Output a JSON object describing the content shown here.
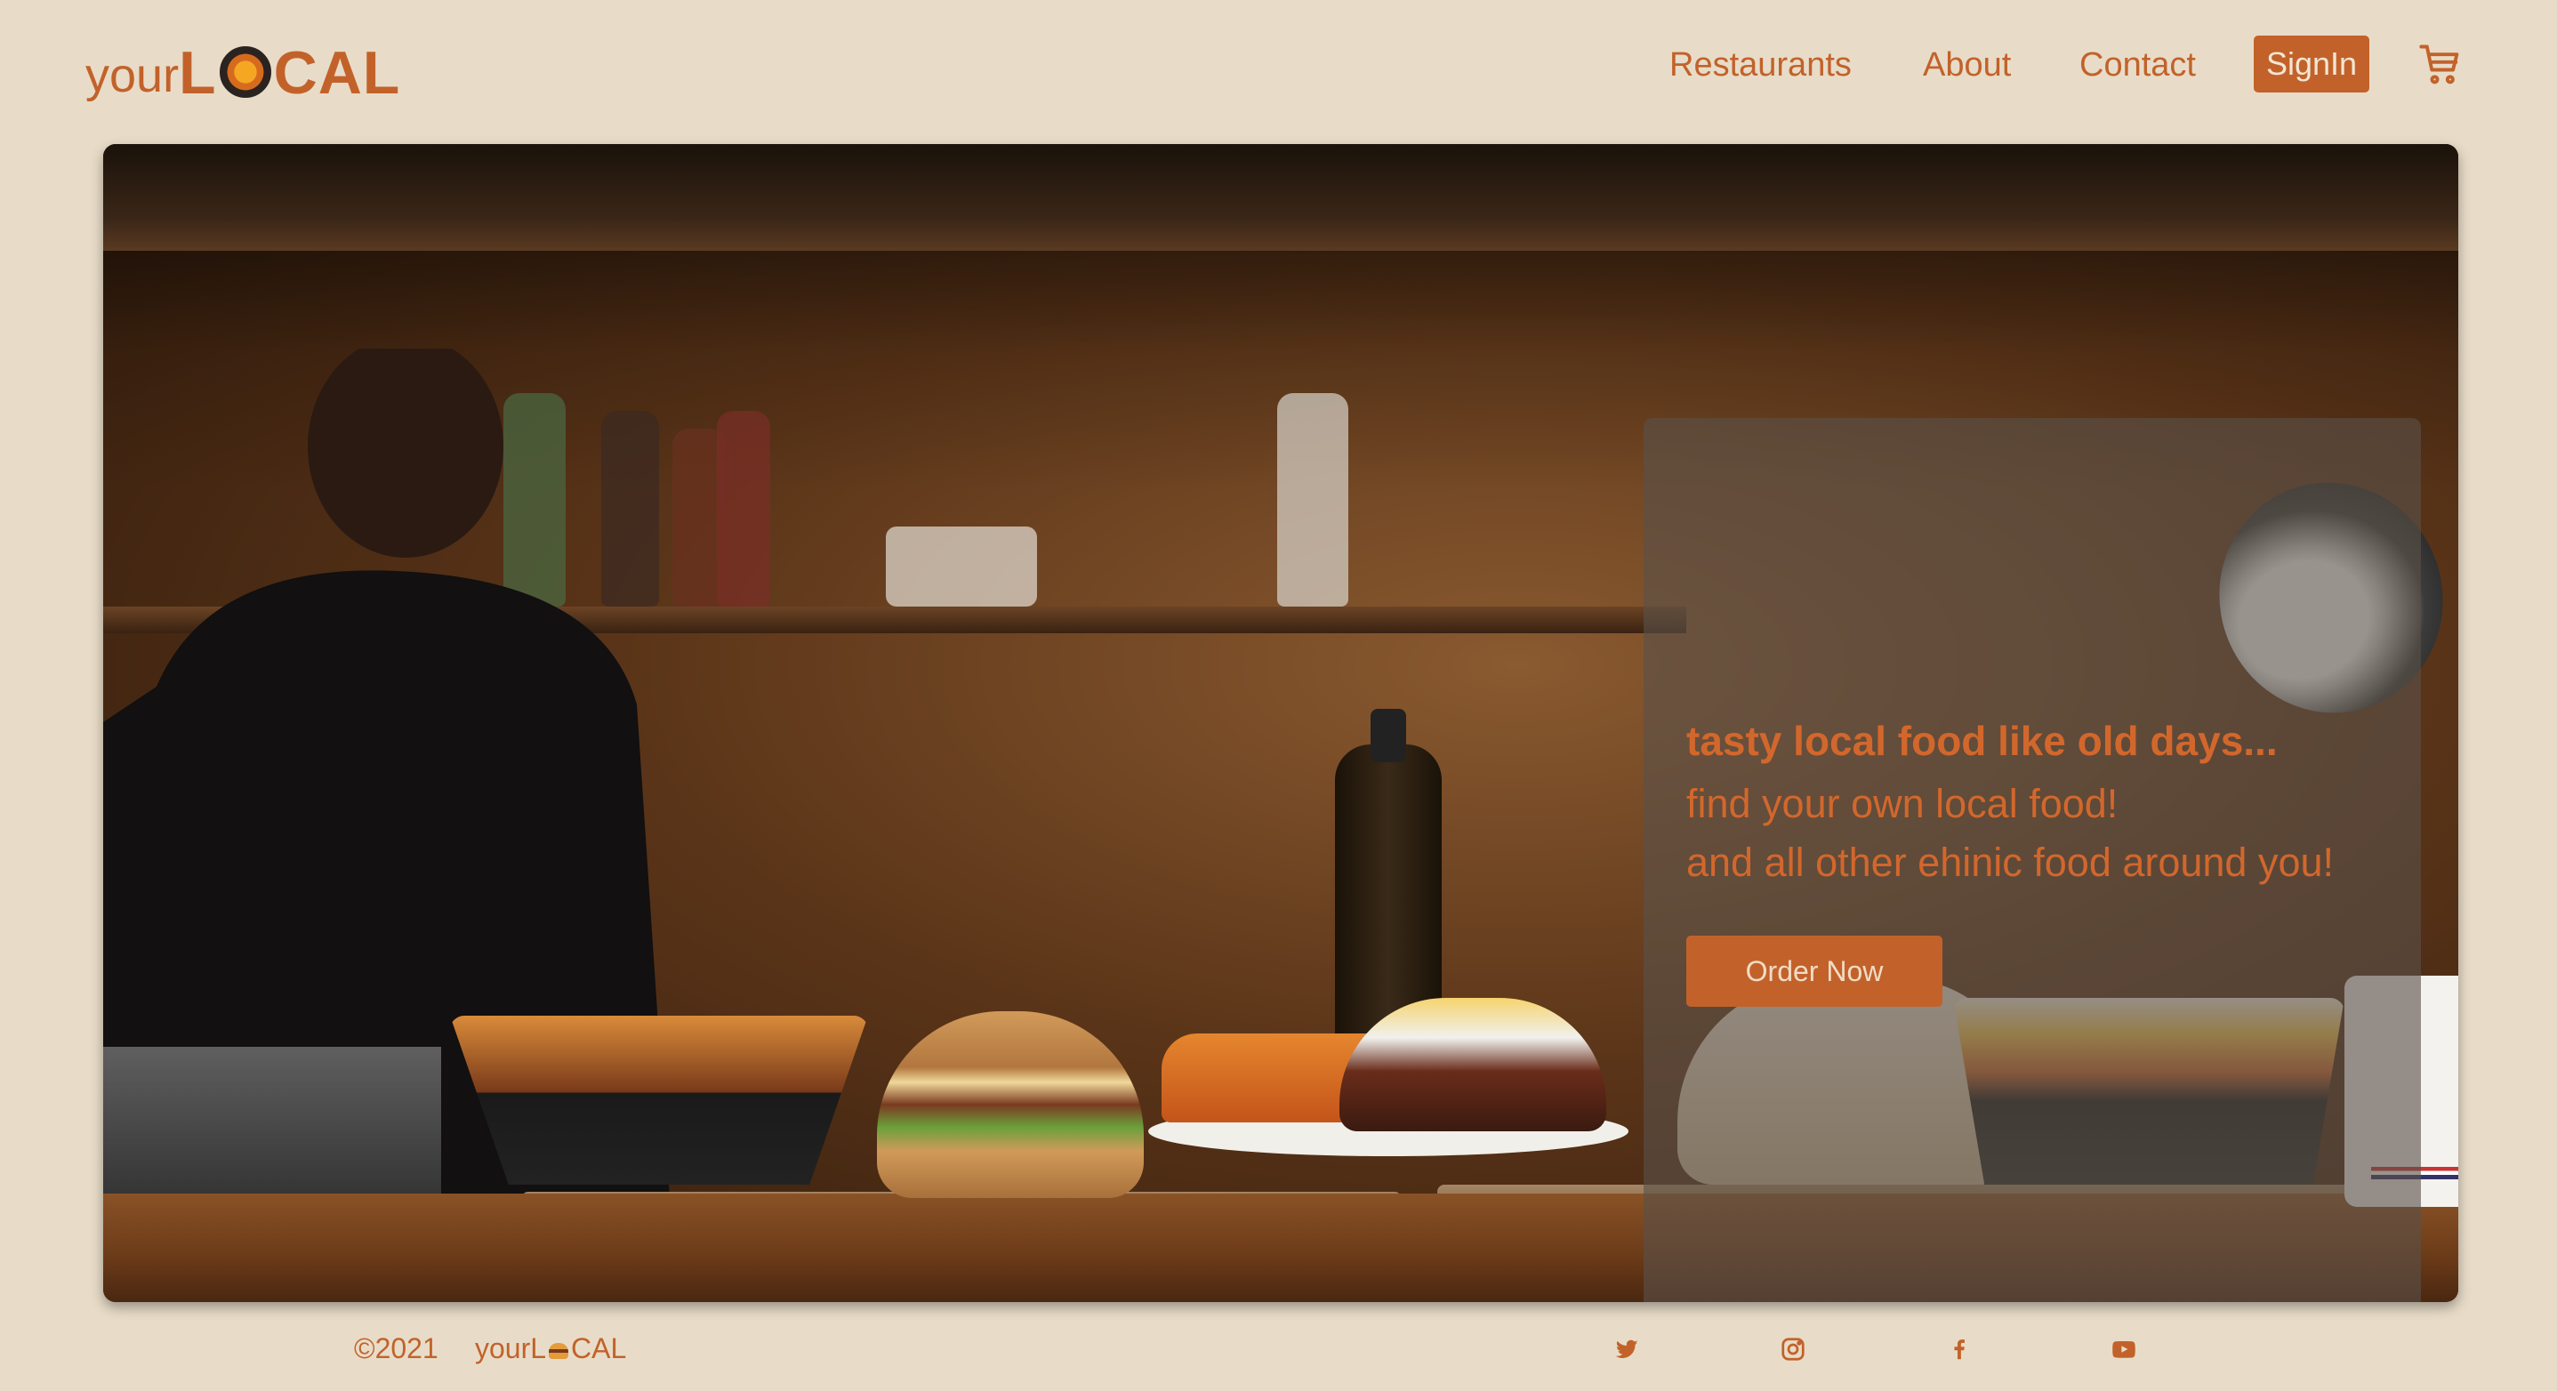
{
  "brand": {
    "prefix": "your",
    "suffix_before_icon": "L",
    "suffix_after_icon": "CAL"
  },
  "nav": {
    "items": [
      {
        "label": "Restaurants"
      },
      {
        "label": "About"
      },
      {
        "label": "Contact"
      }
    ],
    "signin_label": "SignIn",
    "cart_icon": "cart-icon"
  },
  "hero": {
    "headline": "tasty local food like old days...",
    "subline_1": "find your own local food!",
    "subline_2": "and all other ehinic food around you!",
    "cta_label": "Order Now"
  },
  "footer": {
    "copyright": "©2021",
    "brand_prefix": "yourL",
    "brand_suffix": "CAL",
    "social_icons": [
      "twitter-icon",
      "instagram-icon",
      "facebook-icon",
      "youtube-icon"
    ]
  },
  "colors": {
    "background": "#e8dcc8",
    "accent": "#c2622a",
    "card_overlay": "#5a5048"
  }
}
